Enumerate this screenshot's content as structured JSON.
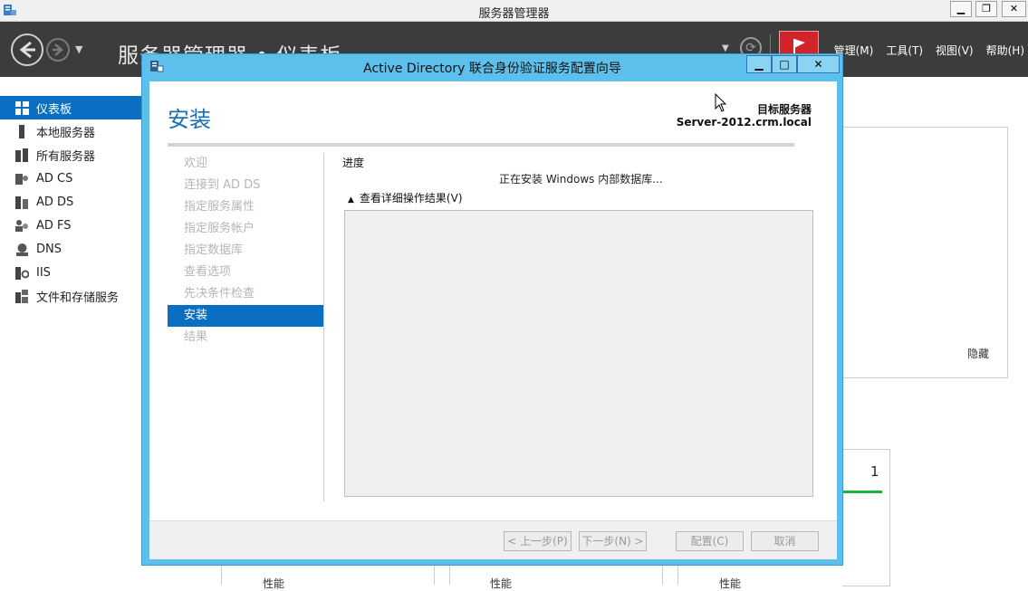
{
  "window": {
    "title": "服务器管理器"
  },
  "toolbar": {
    "breadcrumb": "服务器管理器 • 仪表板",
    "menus": [
      "管理(M)",
      "工具(T)",
      "视图(V)",
      "帮助(H)"
    ]
  },
  "sidebar": {
    "items": [
      {
        "label": "仪表板",
        "icon": "dashboard-icon"
      },
      {
        "label": "本地服务器",
        "icon": "server-icon"
      },
      {
        "label": "所有服务器",
        "icon": "servers-icon"
      },
      {
        "label": "AD CS",
        "icon": "certificate-icon"
      },
      {
        "label": "AD DS",
        "icon": "directory-icon"
      },
      {
        "label": "AD FS",
        "icon": "federation-icon"
      },
      {
        "label": "DNS",
        "icon": "dns-icon"
      },
      {
        "label": "IIS",
        "icon": "iis-icon"
      },
      {
        "label": "文件和存储服务",
        "icon": "storage-icon"
      }
    ]
  },
  "background": {
    "hide_label": "隐藏",
    "tile_count": "1",
    "perf_label": "性能"
  },
  "dialog": {
    "title": "Active Directory 联合身份验证服务配置向导",
    "heading": "安装",
    "target_label": "目标服务器",
    "target_server": "Server-2012.crm.local",
    "steps": [
      "欢迎",
      "连接到 AD DS",
      "指定服务属性",
      "指定服务帐户",
      "指定数据库",
      "查看选项",
      "先决条件检查",
      "安装",
      "结果"
    ],
    "current_step": "安装",
    "progress_title": "进度",
    "progress_text": "正在安装 Windows 内部数据库...",
    "details_toggle": "查看详细操作结果(V)",
    "buttons": {
      "prev": "< 上一步(P)",
      "next": "下一步(N) >",
      "configure": "配置(C)",
      "cancel": "取消"
    }
  },
  "colors": {
    "accent": "#0a6fc2",
    "dialog_frame": "#5dc0ec",
    "toolbar": "#3c3c3c",
    "flag": "#d2232a"
  }
}
